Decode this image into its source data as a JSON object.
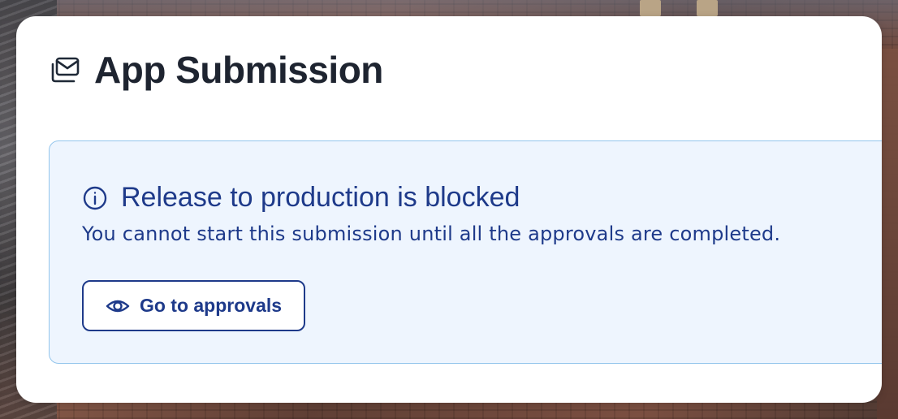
{
  "page": {
    "title": "App Submission",
    "title_icon": "inbox-stack-icon"
  },
  "alert": {
    "title": "Release to production is blocked",
    "description": "You cannot start this submission until all the approvals are completed.",
    "icon": "info-circle-icon",
    "button": {
      "label": "Go to approvals",
      "icon": "eye-icon"
    }
  },
  "colors": {
    "title_text": "#1e2430",
    "alert_text": "#1e3a8a",
    "alert_background": "#eef5fe",
    "alert_border": "#93c5ec",
    "card_background": "#ffffff"
  }
}
